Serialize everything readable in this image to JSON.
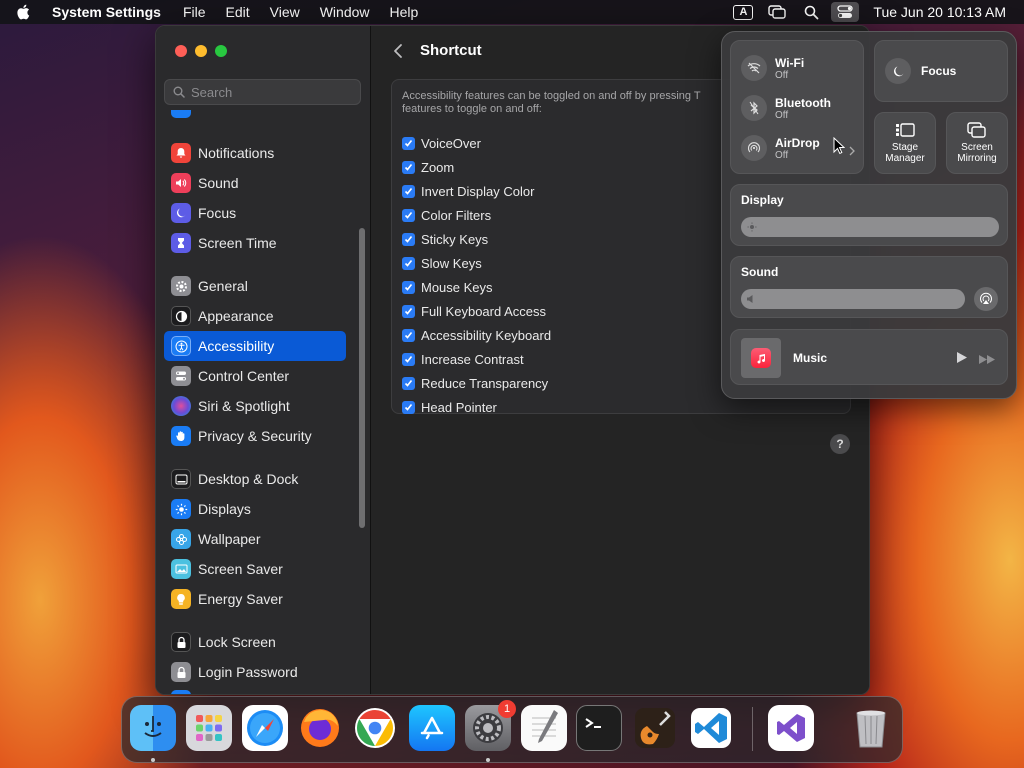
{
  "menubar": {
    "app_name": "System Settings",
    "items": [
      "File",
      "Edit",
      "View",
      "Window",
      "Help"
    ],
    "input_indicator": "A",
    "clock": "Tue Jun 20  10:13 AM"
  },
  "sidebar": {
    "search_placeholder": "Search",
    "groups": [
      [
        {
          "label": "Notifications",
          "icon": "bell-icon",
          "color": "#f0443a"
        },
        {
          "label": "Sound",
          "icon": "speaker-icon",
          "color": "#ee3f5a"
        },
        {
          "label": "Focus",
          "icon": "moon-icon",
          "color": "#5d5ce6"
        },
        {
          "label": "Screen Time",
          "icon": "hourglass-icon",
          "color": "#5d5ce6"
        }
      ],
      [
        {
          "label": "General",
          "icon": "gear-icon",
          "color": "#8e8e93"
        },
        {
          "label": "Appearance",
          "icon": "appearance-icon",
          "color": "#1c1c1e"
        },
        {
          "label": "Accessibility",
          "icon": "accessibility-icon",
          "color": "#1a7cf5",
          "selected": true
        },
        {
          "label": "Control Center",
          "icon": "control-center-icon",
          "color": "#8e8e93"
        },
        {
          "label": "Siri & Spotlight",
          "icon": "siri-icon",
          "color": "#9b59b6"
        },
        {
          "label": "Privacy & Security",
          "icon": "hand-icon",
          "color": "#1a7cf5"
        }
      ],
      [
        {
          "label": "Desktop & Dock",
          "icon": "dock-icon",
          "color": "#1c1c1e"
        },
        {
          "label": "Displays",
          "icon": "sun-icon",
          "color": "#1a7cf5"
        },
        {
          "label": "Wallpaper",
          "icon": "flower-icon",
          "color": "#38a5e8"
        },
        {
          "label": "Screen Saver",
          "icon": "screen-saver-icon",
          "color": "#4cc1e0"
        },
        {
          "label": "Energy Saver",
          "icon": "bulb-icon",
          "color": "#f5b324"
        }
      ],
      [
        {
          "label": "Lock Screen",
          "icon": "lock-icon",
          "color": "#1c1c1e"
        },
        {
          "label": "Login Password",
          "icon": "password-icon",
          "color": "#8e8e93"
        }
      ]
    ]
  },
  "main": {
    "title": "Shortcut",
    "description": "Accessibility features can be toggled on and off by pressing T features to toggle on and off:",
    "features": [
      {
        "label": "VoiceOver",
        "checked": true
      },
      {
        "label": "Zoom",
        "checked": true
      },
      {
        "label": "Invert Display Color",
        "checked": true
      },
      {
        "label": "Color Filters",
        "checked": true
      },
      {
        "label": "Sticky Keys",
        "checked": true
      },
      {
        "label": "Slow Keys",
        "checked": true
      },
      {
        "label": "Mouse Keys",
        "checked": true
      },
      {
        "label": "Full Keyboard Access",
        "checked": true
      },
      {
        "label": "Accessibility Keyboard",
        "checked": true
      },
      {
        "label": "Increase Contrast",
        "checked": true
      },
      {
        "label": "Reduce Transparency",
        "checked": true
      },
      {
        "label": "Head Pointer",
        "checked": true
      }
    ],
    "help": "?"
  },
  "control_center": {
    "wifi": {
      "name": "Wi-Fi",
      "status": "Off"
    },
    "bluetooth": {
      "name": "Bluetooth",
      "status": "Off"
    },
    "airdrop": {
      "name": "AirDrop",
      "status": "Off"
    },
    "focus": "Focus",
    "stage_manager": "Stage Manager",
    "screen_mirroring": "Screen Mirroring",
    "display": {
      "label": "Display",
      "level": 1.0
    },
    "sound": {
      "label": "Sound",
      "level": 1.0
    },
    "music": {
      "label": "Music"
    }
  },
  "dock": {
    "apps": [
      "finder-icon",
      "launchpad-icon",
      "safari-icon",
      "firefox-icon",
      "chrome-icon",
      "app-store-icon",
      "system-settings-icon",
      "textedit-icon",
      "terminal-icon",
      "garageband-icon",
      "vscode-icon",
      "visual-studio-icon",
      "trash-icon"
    ],
    "settings_badge": "1"
  }
}
